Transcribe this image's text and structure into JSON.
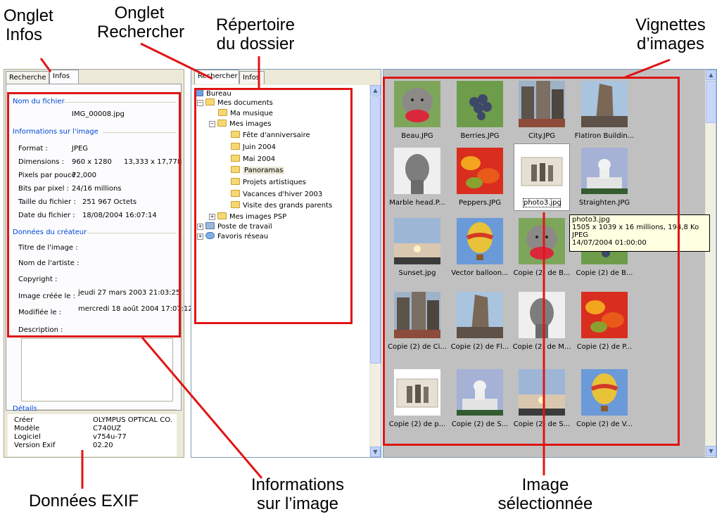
{
  "callouts": {
    "onglet_infos": [
      "Onglet",
      "Infos"
    ],
    "onglet_rechercher": [
      "Onglet",
      "Rechercher"
    ],
    "repertoire": [
      "Répertoire",
      "du dossier"
    ],
    "vignettes": [
      "Vignettes",
      "d’images"
    ],
    "exif": "Données EXIF",
    "informations": [
      "Informations",
      "sur l’image"
    ],
    "selection": [
      "Image",
      "sélectionnée"
    ]
  },
  "left_panel": {
    "tabs": [
      "Recherche",
      "Infos"
    ],
    "file_group": "Nom du fichier",
    "file_name": "IMG_00008.jpg",
    "image_group": "Informations sur l'image",
    "format_label": "Format :",
    "format_value": "JPEG",
    "dimensions_label": "Dimensions :",
    "dimensions_value": "960 x 1280",
    "dimensions_extra": "13,333 x 17,778",
    "ppi_label": "Pixels par pouce",
    "ppi_value": "72,000",
    "bpp_label": "Bits par pixel :",
    "bpp_value": "24/16 millions",
    "size_label": "Taille du fichier :",
    "size_value": "251 967  Octets",
    "date_label": "Date du fichier :",
    "date_value": "18/08/2004 16:07:14",
    "creator_group": "Données du créateur",
    "title_label": "Titre de l'image :",
    "artist_label": "Nom de l'artiste :",
    "copyright_label": "Copyright :",
    "created_label": "Image créée le :",
    "created_value": "jeudi 27 mars 2003 21:03:25",
    "modified_label": "Modifiée le :",
    "modified_value": "mercredi 18 août 2004 17:07:12",
    "desc_label": "Description :",
    "details_group": "Détails",
    "details": [
      {
        "k": "Créer",
        "v": "OLYMPUS OPTICAL CO."
      },
      {
        "k": "Modèle",
        "v": "C740UZ"
      },
      {
        "k": "Logiciel",
        "v": "v754u-77"
      },
      {
        "k": "Version Exif",
        "v": "02.20"
      }
    ]
  },
  "tree_panel": {
    "tabs": [
      "Rechercher",
      "Infos"
    ],
    "items": [
      {
        "label": "Bureau",
        "icon": "desktop-icon"
      },
      {
        "label": "Mes documents",
        "icon": "documents-folder-icon"
      },
      {
        "label": "Ma musique",
        "icon": "music-folder-icon"
      },
      {
        "label": "Mes images",
        "icon": "pictures-folder-icon"
      },
      {
        "label": "Fête d'anniversaire",
        "icon": "folder-icon"
      },
      {
        "label": "Juin 2004",
        "icon": "folder-icon"
      },
      {
        "label": "Mai 2004",
        "icon": "folder-icon"
      },
      {
        "label": "Panoramas",
        "icon": "folder-icon"
      },
      {
        "label": "Projets artistiques",
        "icon": "folder-icon"
      },
      {
        "label": "Vacances d'hiver 2003",
        "icon": "folder-icon"
      },
      {
        "label": "Visite des grands parents",
        "icon": "folder-icon"
      },
      {
        "label": "Mes images PSP",
        "icon": "folder-icon"
      },
      {
        "label": "Poste de travail",
        "icon": "computer-icon"
      },
      {
        "label": "Favoris réseau",
        "icon": "network-icon"
      }
    ]
  },
  "thumbnails": [
    {
      "caption": "Beau.JPG",
      "kind": "dog"
    },
    {
      "caption": "Berries.JPG",
      "kind": "berries"
    },
    {
      "caption": "City.JPG",
      "kind": "city"
    },
    {
      "caption": "Flatiron Buildin...",
      "kind": "flatiron"
    },
    {
      "caption": "Marble head.P...",
      "kind": "marble"
    },
    {
      "caption": "Peppers.JPG",
      "kind": "peppers"
    },
    {
      "caption": "photo3.jpg",
      "kind": "photo"
    },
    {
      "caption": "Straighten.JPG",
      "kind": "capitol"
    },
    {
      "caption": "Sunset.jpg",
      "kind": "sunset"
    },
    {
      "caption": "Vector balloon...",
      "kind": "balloon"
    },
    {
      "caption": "Copie (2) de B...",
      "kind": "dog"
    },
    {
      "caption": "Copie (2) de B...",
      "kind": "berries"
    },
    {
      "caption": "Copie (2) de Ci...",
      "kind": "city"
    },
    {
      "caption": "Copie (2) de Fl...",
      "kind": "flatiron"
    },
    {
      "caption": "Copie (2) de M...",
      "kind": "marble"
    },
    {
      "caption": "Copie (2) de P...",
      "kind": "peppers"
    },
    {
      "caption": "Copie (2) de p...",
      "kind": "photo"
    },
    {
      "caption": "Copie (2) de S...",
      "kind": "capitol"
    },
    {
      "caption": "Copie (2) de S...",
      "kind": "sunset"
    },
    {
      "caption": "Copie (2) de V...",
      "kind": "balloon"
    }
  ],
  "tooltip": {
    "lines": [
      "photo3.jpg",
      "1505 x 1039 x 16 millions, 194,8 Ko",
      "JPEG",
      "14/07/2004 01:00:00"
    ]
  },
  "colors": {
    "annotation_red": "#e01515",
    "panel_bg": "#ece9d8",
    "group_title": "#0046d5",
    "thumb_bg": "#c0c0c0"
  }
}
